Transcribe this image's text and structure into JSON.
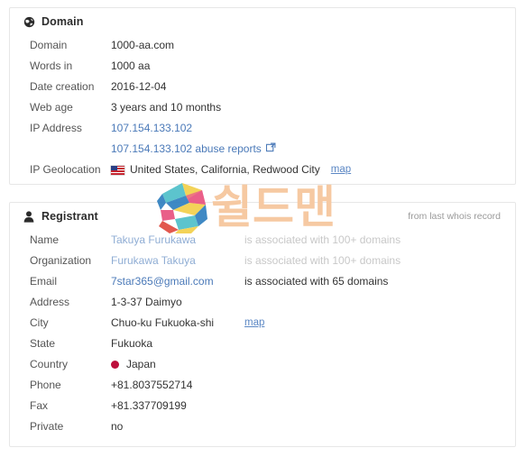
{
  "domain_card": {
    "icon": "globe-icon",
    "title": "Domain",
    "rows": [
      {
        "label": "Domain",
        "value": "1000-aa.com"
      },
      {
        "label": "Words in",
        "value": "1000 aa"
      },
      {
        "label": "Date creation",
        "value": "2016-12-04"
      },
      {
        "label": "Web age",
        "value": "3 years and 10 months"
      },
      {
        "label": "IP Address",
        "value": "107.154.133.102"
      },
      {
        "label": "",
        "value": "107.154.133.102 abuse reports",
        "icon": "external-link-icon"
      },
      {
        "label": "IP Geolocation",
        "value": "United States, California, Redwood City",
        "flag": "us-flag-icon",
        "map_label": "map"
      }
    ]
  },
  "registrant_card": {
    "icon": "user-icon",
    "title": "Registrant",
    "note": "from last whois record",
    "rows": [
      {
        "label": "Name",
        "value": "Takuya Furukawa",
        "extra": "is associated with 100+ domains"
      },
      {
        "label": "Organization",
        "value": "Furukawa Takuya",
        "extra": "is associated with 100+ domains"
      },
      {
        "label": "Email",
        "value": "7star365@gmail.com",
        "extra": "is associated with 65 domains"
      },
      {
        "label": "Address",
        "value": "1-3-37 Daimyo"
      },
      {
        "label": "City",
        "value": "Chuo-ku Fukuoka-shi",
        "map_label": "map"
      },
      {
        "label": "State",
        "value": "Fukuoka"
      },
      {
        "label": "Country",
        "value": "Japan",
        "flag": "jp-flag-icon"
      },
      {
        "label": "Phone",
        "value": "+81.8037552714"
      },
      {
        "label": "Fax",
        "value": "+81.337709199"
      },
      {
        "label": "Private",
        "value": "no"
      }
    ]
  },
  "watermark": {
    "logo_text": "S",
    "text": "쉴드맨",
    "text_color": "#f6c9a2",
    "colors": [
      "#3fb6c4",
      "#2f7fbf",
      "#e8527f",
      "#f2d04a",
      "#e04a3f",
      "#8fd3d8"
    ]
  },
  "link_color": "#4a79b8",
  "muted_color": "#c8c8c8"
}
